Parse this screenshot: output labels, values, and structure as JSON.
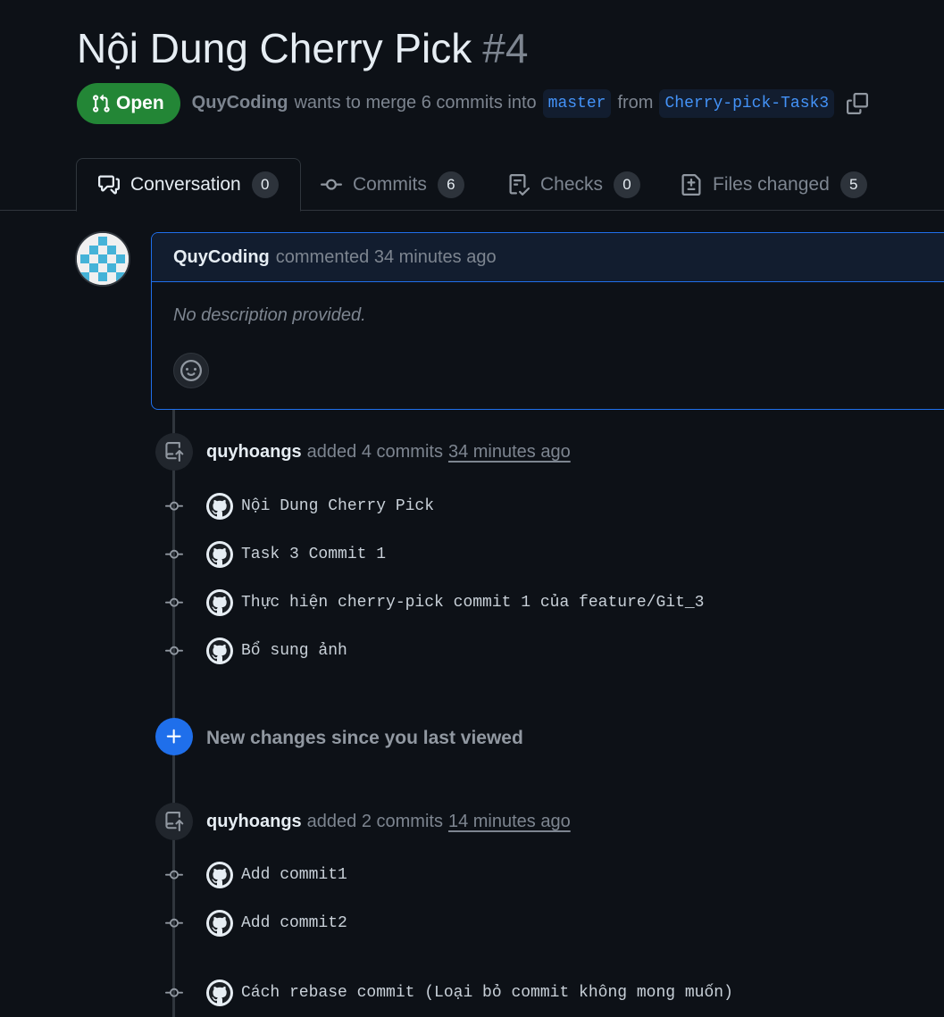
{
  "pull_request": {
    "title": "Nội Dung Cherry Pick",
    "number": "#4",
    "state": "Open",
    "author": "QuyCoding",
    "merge_text": "wants to merge 6 commits into",
    "base_branch": "master",
    "from_text": "from",
    "head_branch": "Cherry-pick-Task3"
  },
  "tabs": [
    {
      "label": "Conversation",
      "count": "0",
      "icon": "comment-discussion-icon"
    },
    {
      "label": "Commits",
      "count": "6",
      "icon": "git-commit-icon"
    },
    {
      "label": "Checks",
      "count": "0",
      "icon": "checklist-icon"
    },
    {
      "label": "Files changed",
      "count": "5",
      "icon": "file-diff-icon"
    }
  ],
  "comment": {
    "author": "QuyCoding",
    "action": "commented 34 minutes ago",
    "body": "No description provided."
  },
  "events": [
    {
      "actor": "quyhoangs",
      "action": "added 4 commits",
      "time": "34 minutes ago",
      "commits": [
        "Nội Dung Cherry Pick",
        "Task 3 Commit 1",
        "Thực hiện cherry-pick commit 1 của feature/Git_3",
        "Bổ sung ảnh"
      ]
    },
    {
      "actor": "quyhoangs",
      "action": "added 2 commits",
      "time": "14 minutes ago",
      "commits": [
        "Add commit1",
        "Add commit2",
        "Cách rebase commit (Loại bỏ commit không mong muốn)"
      ]
    }
  ],
  "new_changes": {
    "label": "New changes since you last viewed"
  },
  "colors": {
    "background": "#0d1117",
    "open_badge": "#238636",
    "accent_blue": "#1f6feb",
    "branch_text": "#4493f8",
    "muted_text": "#7d8590"
  }
}
